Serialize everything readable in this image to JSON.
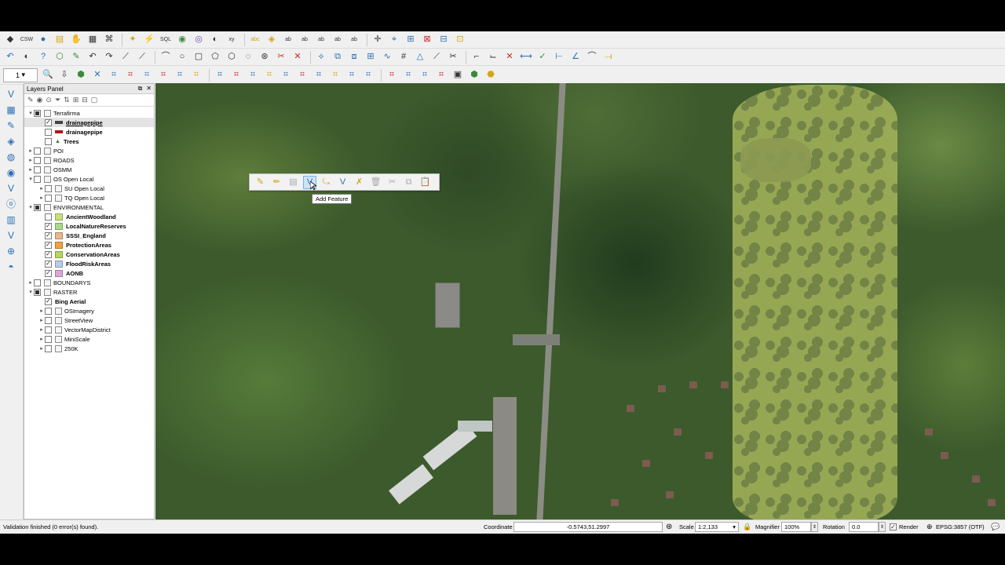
{
  "toolbar": {
    "row1": [
      {
        "name": "pencil-edit-icon",
        "glyph": "◆",
        "color": "dark"
      },
      {
        "name": "csw-icon",
        "glyph": "CSW",
        "color": "dark"
      },
      {
        "name": "python-icon",
        "glyph": "●",
        "color": "blue"
      },
      {
        "name": "identify-form-icon",
        "glyph": "▤",
        "color": "gold"
      },
      {
        "name": "pan-icon",
        "glyph": "✋",
        "color": "blue"
      },
      {
        "name": "clipboard-icon",
        "glyph": "▦",
        "color": "dark"
      },
      {
        "name": "binoculars-icon",
        "glyph": "⌘",
        "color": "dark"
      },
      {
        "name": "run-icon",
        "glyph": "✦",
        "color": "gold"
      },
      {
        "name": "action-icon",
        "glyph": "⚡",
        "color": "gold"
      },
      {
        "name": "sql-icon",
        "glyph": "SQL",
        "color": "dark"
      },
      {
        "name": "globe-icon",
        "glyph": "◉",
        "color": "green"
      },
      {
        "name": "settings-icon",
        "glyph": "◎",
        "color": "purple"
      },
      {
        "name": "eye-icon",
        "glyph": "◐",
        "color": "dark"
      },
      {
        "name": "xy-point-icon",
        "glyph": "xy",
        "color": "dark"
      },
      {
        "name": "label-abc-icon",
        "glyph": "abc",
        "color": "gold"
      },
      {
        "name": "label-pin-icon",
        "glyph": "◈",
        "color": "gold"
      },
      {
        "name": "label-move-icon",
        "glyph": "ab",
        "color": "dark"
      },
      {
        "name": "label-rotate-icon",
        "glyph": "ab",
        "color": "dark"
      },
      {
        "name": "label-change-icon",
        "glyph": "ab",
        "color": "dark"
      },
      {
        "name": "label-show-icon",
        "glyph": "ab",
        "color": "dark"
      },
      {
        "name": "label-hide-icon",
        "glyph": "ab",
        "color": "dark"
      },
      {
        "name": "cadd-icon",
        "glyph": "✛",
        "color": "dark"
      },
      {
        "name": "digitize-icon",
        "glyph": "⌖",
        "color": "blue"
      },
      {
        "name": "layer-props-icon",
        "glyph": "⊞",
        "color": "blue"
      },
      {
        "name": "tool-a-icon",
        "glyph": "⊠",
        "color": "red"
      },
      {
        "name": "tool-b-icon",
        "glyph": "⊟",
        "color": "blue"
      },
      {
        "name": "tool-c-icon",
        "glyph": "⊡",
        "color": "gold"
      }
    ],
    "row2": [
      {
        "name": "undo-icon",
        "glyph": "↶",
        "color": "blue"
      },
      {
        "name": "rotate-map-icon",
        "glyph": "◐",
        "color": "dark"
      },
      {
        "name": "help-icon",
        "glyph": "?",
        "color": "blue"
      },
      {
        "name": "node-tool-icon",
        "glyph": "⬡",
        "color": "green"
      },
      {
        "name": "vertex-icon",
        "glyph": "✎",
        "color": "green"
      },
      {
        "name": "undo-edit-icon",
        "glyph": "↶",
        "color": "dark"
      },
      {
        "name": "redo-edit-icon",
        "glyph": "↷",
        "color": "dark"
      },
      {
        "name": "line-tool-icon",
        "glyph": "⟋",
        "color": "dark"
      },
      {
        "name": "polyline-icon",
        "glyph": "⟋",
        "color": "dark"
      },
      {
        "name": "arc-icon",
        "glyph": "⌒",
        "color": "dark"
      },
      {
        "name": "circle-icon",
        "glyph": "○",
        "color": "dark"
      },
      {
        "name": "square-icon",
        "glyph": "▢",
        "color": "dark"
      },
      {
        "name": "pentagon-icon",
        "glyph": "⬠",
        "color": "dark"
      },
      {
        "name": "polygon-icon",
        "glyph": "⬡",
        "color": "dark"
      },
      {
        "name": "lasso-icon",
        "glyph": "◌",
        "color": "dark"
      },
      {
        "name": "shape-icon",
        "glyph": "⊛",
        "color": "dark"
      },
      {
        "name": "cut-icon",
        "glyph": "✂",
        "color": "red"
      },
      {
        "name": "delete-part-icon",
        "glyph": "✕",
        "color": "red"
      },
      {
        "name": "reshape-icon",
        "glyph": "⟡",
        "color": "blue"
      },
      {
        "name": "offset-icon",
        "glyph": "⧉",
        "color": "blue"
      },
      {
        "name": "split-icon",
        "glyph": "⧈",
        "color": "blue"
      },
      {
        "name": "merge-icon",
        "glyph": "⊞",
        "color": "blue"
      },
      {
        "name": "spline-icon",
        "glyph": "∿",
        "color": "blue"
      },
      {
        "name": "grid-icon",
        "glyph": "#",
        "color": "dark"
      },
      {
        "name": "triangle-icon",
        "glyph": "△",
        "color": "blue"
      },
      {
        "name": "extend-icon",
        "glyph": "⟋",
        "color": "dark"
      },
      {
        "name": "trim-icon",
        "glyph": "✂",
        "color": "dark"
      },
      {
        "name": "fillet-icon",
        "glyph": "⌐",
        "color": "dark"
      },
      {
        "name": "chamfer-icon",
        "glyph": "⌙",
        "color": "dark"
      },
      {
        "name": "delete-icon",
        "glyph": "✕",
        "color": "red"
      },
      {
        "name": "measure-icon",
        "glyph": "⟷",
        "color": "blue"
      },
      {
        "name": "check-icon",
        "glyph": "✓",
        "color": "green"
      },
      {
        "name": "dimension-icon",
        "glyph": "⊢",
        "color": "blue"
      },
      {
        "name": "angle-icon",
        "glyph": "∠",
        "color": "blue"
      },
      {
        "name": "curve-icon",
        "glyph": "⌒",
        "color": "dark"
      },
      {
        "name": "tape-icon",
        "glyph": "⟞",
        "color": "gold"
      }
    ],
    "row3_scale": "1",
    "row3": [
      {
        "name": "zoom-icon",
        "glyph": "🔍",
        "color": "dark"
      },
      {
        "name": "pin-icon",
        "glyph": "⇩",
        "color": "dark"
      },
      {
        "name": "feature-icon",
        "glyph": "⬢",
        "color": "green"
      },
      {
        "name": "x-icon",
        "glyph": "✕",
        "color": "blue"
      },
      {
        "name": "snap-1-icon",
        "glyph": "⌗",
        "color": "blue"
      },
      {
        "name": "snap-2-icon",
        "glyph": "⌗",
        "color": "red"
      },
      {
        "name": "snap-3-icon",
        "glyph": "⌗",
        "color": "blue"
      },
      {
        "name": "snap-4-icon",
        "glyph": "⌗",
        "color": "red"
      },
      {
        "name": "snap-5-icon",
        "glyph": "⌗",
        "color": "blue"
      },
      {
        "name": "snap-6-icon",
        "glyph": "⌗",
        "color": "gold"
      },
      {
        "name": "snap-7-icon",
        "glyph": "⌗",
        "color": "blue"
      },
      {
        "name": "snap-8-icon",
        "glyph": "⌗",
        "color": "red"
      },
      {
        "name": "snap-9-icon",
        "glyph": "⌗",
        "color": "blue"
      },
      {
        "name": "snap-10-icon",
        "glyph": "⌗",
        "color": "gold"
      },
      {
        "name": "snap-11-icon",
        "glyph": "⌗",
        "color": "blue"
      },
      {
        "name": "snap-12-icon",
        "glyph": "⌗",
        "color": "red"
      },
      {
        "name": "snap-13-icon",
        "glyph": "⌗",
        "color": "blue"
      },
      {
        "name": "snap-14-icon",
        "glyph": "⌗",
        "color": "gold"
      },
      {
        "name": "snap-15-icon",
        "glyph": "⌗",
        "color": "blue"
      },
      {
        "name": "snap-16-icon",
        "glyph": "⌗",
        "color": "blue"
      },
      {
        "name": "snap-17-icon",
        "glyph": "⌗",
        "color": "red"
      },
      {
        "name": "snap-18-icon",
        "glyph": "⌗",
        "color": "blue"
      },
      {
        "name": "snap-19-icon",
        "glyph": "⌗",
        "color": "blue"
      },
      {
        "name": "snap-20-icon",
        "glyph": "⌗",
        "color": "red"
      },
      {
        "name": "terminal-icon",
        "glyph": "▣",
        "color": "dark"
      },
      {
        "name": "plugin-hex-icon",
        "glyph": "⬢",
        "color": "green"
      },
      {
        "name": "style-icon",
        "glyph": "⬣",
        "color": "gold"
      }
    ]
  },
  "left_toolbar": [
    {
      "name": "add-vector-icon",
      "glyph": "V"
    },
    {
      "name": "add-raster-icon",
      "glyph": "▦"
    },
    {
      "name": "add-delimited-icon",
      "glyph": "✎"
    },
    {
      "name": "add-spatialite-icon",
      "glyph": "◈"
    },
    {
      "name": "add-wms-icon",
      "glyph": "◍"
    },
    {
      "name": "add-wfs-icon",
      "glyph": "◉"
    },
    {
      "name": "add-mssql-icon",
      "glyph": "V"
    },
    {
      "name": "add-oracle-icon",
      "glyph": "ⓞ"
    },
    {
      "name": "add-db2-icon",
      "glyph": "▥"
    },
    {
      "name": "new-layer-icon",
      "glyph": "V"
    },
    {
      "name": "virtual-layer-icon",
      "glyph": "⊕"
    },
    {
      "name": "temp-layer-icon",
      "glyph": "◓"
    }
  ],
  "layers_panel": {
    "title": "Layers Panel",
    "float_btn": "⧉",
    "close_btn": "✕",
    "tools": [
      "✎",
      "◉",
      "⊙",
      "⏷",
      "⇅",
      "⊞",
      "⊟",
      "▢"
    ],
    "tree": [
      {
        "indent": 0,
        "arrow": "▾",
        "check": "partial",
        "kind": "group",
        "label": "Terrafirma"
      },
      {
        "indent": 1,
        "arrow": "",
        "check": "checked",
        "kind": "pipe",
        "label": "drainagepipe",
        "bold": true,
        "selected": true,
        "underline": true
      },
      {
        "indent": 1,
        "arrow": "",
        "check": "",
        "kind": "pipe-red",
        "label": "drainagepipe",
        "bold": true
      },
      {
        "indent": 1,
        "arrow": "",
        "check": "",
        "kind": "tree",
        "label": "Trees",
        "bold": true
      },
      {
        "indent": 0,
        "arrow": "▸",
        "check": "",
        "kind": "group",
        "label": "POI"
      },
      {
        "indent": 0,
        "arrow": "▸",
        "check": "",
        "kind": "group",
        "label": "ROADS"
      },
      {
        "indent": 0,
        "arrow": "▸",
        "check": "",
        "kind": "group",
        "label": "OSMM"
      },
      {
        "indent": 0,
        "arrow": "▾",
        "check": "",
        "kind": "group",
        "label": "OS Open Local"
      },
      {
        "indent": 1,
        "arrow": "▸",
        "check": "",
        "kind": "group",
        "label": "SU Open Local"
      },
      {
        "indent": 1,
        "arrow": "▸",
        "check": "",
        "kind": "group",
        "label": "TQ Open Local"
      },
      {
        "indent": 0,
        "arrow": "▾",
        "check": "partial",
        "kind": "group",
        "label": "ENVIRONMENTAL"
      },
      {
        "indent": 1,
        "arrow": "",
        "check": "",
        "kind": "fill",
        "color": "#c8e07a",
        "label": "AncientWoodland",
        "bold": true
      },
      {
        "indent": 1,
        "arrow": "",
        "check": "checked",
        "kind": "fill",
        "color": "#a9d98a",
        "label": "LocalNatureReserves",
        "bold": true
      },
      {
        "indent": 1,
        "arrow": "",
        "check": "checked",
        "kind": "fill",
        "color": "#e8b88a",
        "label": "SSSI_England",
        "bold": true
      },
      {
        "indent": 1,
        "arrow": "",
        "check": "checked",
        "kind": "fill",
        "color": "#f2a040",
        "label": "ProtectionAreas",
        "bold": true
      },
      {
        "indent": 1,
        "arrow": "",
        "check": "checked",
        "kind": "fill",
        "color": "#b7d65a",
        "label": "ConservationAreas",
        "bold": true
      },
      {
        "indent": 1,
        "arrow": "",
        "check": "checked",
        "kind": "fill",
        "color": "#b9cde8",
        "label": "FloodRiskAreas",
        "bold": true
      },
      {
        "indent": 1,
        "arrow": "",
        "check": "checked",
        "kind": "fill",
        "color": "#d9a8d8",
        "label": "AONB",
        "bold": true
      },
      {
        "indent": 0,
        "arrow": "▸",
        "check": "",
        "kind": "group",
        "label": "BOUNDARYS"
      },
      {
        "indent": 0,
        "arrow": "▾",
        "check": "partial",
        "kind": "group",
        "label": "RASTER"
      },
      {
        "indent": 1,
        "arrow": "",
        "check": "checked",
        "kind": "none",
        "label": "Bing Aerial",
        "bold": true
      },
      {
        "indent": 1,
        "arrow": "▸",
        "check": "",
        "kind": "group",
        "label": "OSImagery"
      },
      {
        "indent": 1,
        "arrow": "▸",
        "check": "",
        "kind": "group",
        "label": "StreetView"
      },
      {
        "indent": 1,
        "arrow": "▸",
        "check": "",
        "kind": "group",
        "label": "VectorMapDistrict"
      },
      {
        "indent": 1,
        "arrow": "▸",
        "check": "",
        "kind": "group",
        "label": "MiniScale"
      },
      {
        "indent": 1,
        "arrow": "▸",
        "check": "",
        "kind": "group",
        "label": "250K"
      }
    ]
  },
  "float_toolbar": [
    {
      "name": "current-edits-icon",
      "glyph": "✎",
      "state": "normal",
      "color": "gold"
    },
    {
      "name": "toggle-editing-icon",
      "glyph": "✏",
      "state": "normal",
      "color": "gold"
    },
    {
      "name": "save-edits-icon",
      "glyph": "▤",
      "state": "disabled",
      "color": "dark"
    },
    {
      "name": "add-feature-icon",
      "glyph": "V",
      "state": "active",
      "color": "blue"
    },
    {
      "name": "move-feature-icon",
      "glyph": "⤿",
      "state": "normal",
      "color": "gold"
    },
    {
      "name": "node-tool-float-icon",
      "glyph": "V",
      "state": "normal",
      "color": "blue"
    },
    {
      "name": "edit-attr-icon",
      "glyph": "✗",
      "state": "normal",
      "color": "gold"
    },
    {
      "name": "delete-selected-icon",
      "glyph": "🗑",
      "state": "disabled",
      "color": "dark"
    },
    {
      "name": "cut-features-icon",
      "glyph": "✂",
      "state": "disabled",
      "color": "dark"
    },
    {
      "name": "copy-features-icon",
      "glyph": "⧉",
      "state": "disabled",
      "color": "dark"
    },
    {
      "name": "paste-features-icon",
      "glyph": "📋",
      "state": "normal",
      "color": "dark"
    }
  ],
  "tooltip": "Add Feature",
  "statusbar": {
    "message": "Validation finished (0 error(s) found).",
    "coordinate_label": "Coordinate",
    "coordinate_value": "-0.5743,51.2997",
    "scale_label": "Scale",
    "scale_value": "1:2,133",
    "magnifier_label": "Magnifier",
    "magnifier_value": "100%",
    "rotation_label": "Rotation",
    "rotation_value": "0.0",
    "render_label": "Render",
    "crs_label": "EPSG:3857 (OTF)"
  },
  "colors": {
    "park_overlay": "#a3b25a",
    "app_bg": "#f0f0f0"
  }
}
